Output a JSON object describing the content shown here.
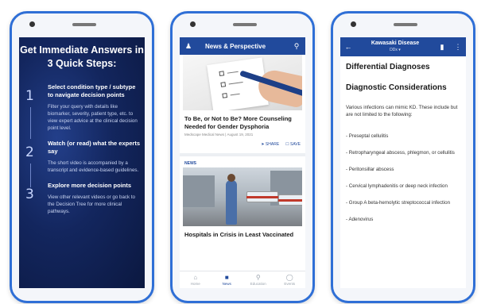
{
  "phone1": {
    "title": "Get Immediate Answers in 3 Quick Steps:",
    "steps": [
      {
        "num": "1",
        "heading": "Select condition type / subtype to navigate decision points",
        "body": "Filter your query with details like biomarker, severity, patient type, etc. to view expert advice at the clinical decision point level."
      },
      {
        "num": "2",
        "heading": "Watch (or read) what the experts say",
        "body": "The short video is accompanied by a transcript and evidence-based guidelines."
      },
      {
        "num": "3",
        "heading": "Explore more decision points",
        "body": "View other relevant videos or go back to the Decision Tree for more clinical pathways."
      }
    ]
  },
  "phone2": {
    "header_title": "News & Perspective",
    "article1": {
      "title": "To Be, or Not to Be? More Counseling Needed for Gender Dysphoria",
      "source": "Medscape Medical News | August 19, 2021",
      "share_label": "SHARE",
      "save_label": "SAVE"
    },
    "section_label": "NEWS",
    "article2": {
      "title": "Hospitals in Crisis in Least Vaccinated"
    },
    "nav": [
      {
        "label": "Home",
        "icon": "home-icon"
      },
      {
        "label": "News",
        "icon": "news-icon"
      },
      {
        "label": "Education",
        "icon": "education-icon"
      },
      {
        "label": "Events",
        "icon": "events-icon"
      }
    ],
    "active_nav": "News"
  },
  "phone3": {
    "header_title": "Kawasaki Disease",
    "header_subtitle": "DDx",
    "heading1": "Differential Diagnoses",
    "heading2": "Diagnostic Considerations",
    "intro": "Various infections can mimic KD. These include but are not limited to the following:",
    "items": [
      "Preseptal cellulitis",
      "Retropharyngeal abscess, phlegmon, or cellulitis",
      "Peritonsillar abscess",
      "Cervical lymphadenitis or deep neck infection",
      "Group A beta-hemolytic streptococcal infection",
      "Adenovirus"
    ]
  },
  "colors": {
    "brand": "#214a9c",
    "phone_frame": "#2f6fd6",
    "dark_bg": "#13265e"
  }
}
